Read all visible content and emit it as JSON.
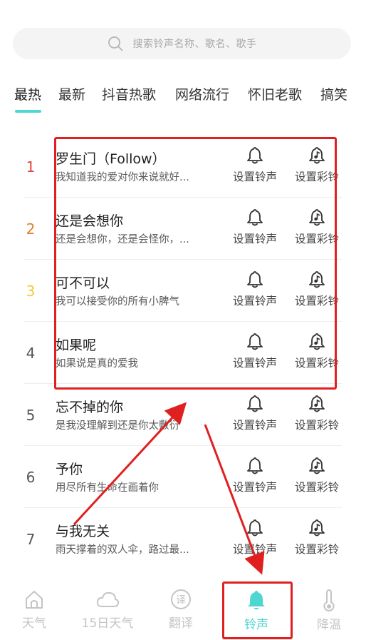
{
  "search": {
    "placeholder": "搜索铃声名称、歌名、歌手"
  },
  "tabs": [
    {
      "label": "最热",
      "active": true
    },
    {
      "label": "最新",
      "active": false
    },
    {
      "label": "抖音热歌",
      "active": false
    },
    {
      "label": "网络流行",
      "active": false
    },
    {
      "label": "怀旧老歌",
      "active": false
    },
    {
      "label": "搞笑",
      "active": false
    }
  ],
  "actions": {
    "set_ringtone": "设置铃声",
    "set_color_ring": "设置彩铃"
  },
  "songs": [
    {
      "rank": "1",
      "title": "罗生门（Follow）",
      "lyric": "我知道我的爱对你来说就好...",
      "rank_color": "#e0443a"
    },
    {
      "rank": "2",
      "title": "还是会想你",
      "lyric": "还是会想你，还是会怪你，...",
      "rank_color": "#d9822b"
    },
    {
      "rank": "3",
      "title": "可不可以",
      "lyric": "我可以接受你的所有小脾气",
      "rank_color": "#f2cb36"
    },
    {
      "rank": "4",
      "title": "如果呢",
      "lyric": "如果说是真的爱我",
      "rank_color": "#555555"
    },
    {
      "rank": "5",
      "title": "忘不掉的你",
      "lyric": "是我没理解到还是你太敷衍",
      "rank_color": "#555555"
    },
    {
      "rank": "6",
      "title": "予你",
      "lyric": "用尽所有生命在画着你",
      "rank_color": "#555555"
    },
    {
      "rank": "7",
      "title": "与我无关",
      "lyric": "雨天撑着的双人伞，路过最...",
      "rank_color": "#555555"
    }
  ],
  "nav": [
    {
      "label": "天气",
      "icon": "house-icon",
      "active": false
    },
    {
      "label": "15日天气",
      "icon": "cloud-icon",
      "active": false
    },
    {
      "label": "翻译",
      "icon": "translate-icon",
      "active": false
    },
    {
      "label": "铃声",
      "icon": "bell-icon",
      "active": true
    },
    {
      "label": "降温",
      "icon": "thermometer-icon",
      "active": false
    }
  ],
  "colors": {
    "accent": "#4ed6d2",
    "annotation": "#e02020",
    "nav_inactive": "#c4c4c4"
  }
}
